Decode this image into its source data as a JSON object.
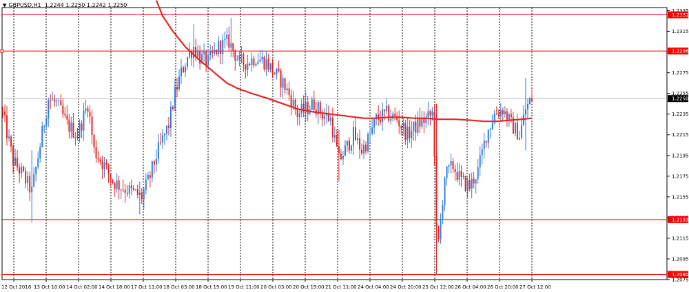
{
  "header": {
    "menu_icon": "dropdown-triangle-icon",
    "symbol": "GBPUSD,H1",
    "open": "1.2244",
    "high": "1.2250",
    "low": "1.2242",
    "close": "1.2250"
  },
  "colors": {
    "bull": "#2f7be0",
    "bear": "#e8231f",
    "ma": "#e8231f",
    "hline": "#ff0000",
    "grid": "#000000",
    "price_line": "#bdbdbd",
    "current_label_bg": "#000000"
  },
  "chart_data": {
    "type": "candlestick",
    "symbol": "GBPUSD",
    "timeframe": "H1",
    "grid": true,
    "ylim": [
      1.2075,
      1.2338
    ],
    "y_ticks": [
      "1.2335",
      "1.2315",
      "1.2295",
      "1.2275",
      "1.2255",
      "1.2235",
      "1.2215",
      "1.2195",
      "1.2175",
      "1.2155",
      "1.2135",
      "1.2115",
      "1.2095",
      "1.2075"
    ],
    "x_labels": [
      "12 Oct 2016",
      "13 Oct 10:00",
      "14 Oct 02:00",
      "14 Oct 18:00",
      "17 Oct 11:00",
      "18 Oct 03:00",
      "18 Oct 19:00",
      "19 Oct 11:00",
      "20 Oct 03:00",
      "20 Oct 19:00",
      "21 Oct 11:00",
      "24 Oct 04:00",
      "24 Oct 20:00",
      "25 Oct 12:00",
      "26 Oct 04:00",
      "26 Oct 20:00",
      "27 Oct 12:00"
    ],
    "horizontal_levels": [
      {
        "price": 1.2331,
        "label": "1.2331"
      },
      {
        "price": 1.2296,
        "label": "1.2296"
      },
      {
        "price": 1.2133,
        "label": "1.2133"
      },
      {
        "price": 1.208,
        "label": "1.2080"
      }
    ],
    "current_price": {
      "price": 1.225,
      "label": "1.2250"
    },
    "bar_count": 256,
    "anchors": [
      [
        0,
        1.2235
      ],
      [
        5,
        1.219
      ],
      [
        10,
        1.2175
      ],
      [
        14,
        1.216
      ],
      [
        18,
        1.2205
      ],
      [
        22,
        1.225
      ],
      [
        26,
        1.2245
      ],
      [
        31,
        1.2225
      ],
      [
        36,
        1.2215
      ],
      [
        41,
        1.2245
      ],
      [
        44,
        1.22
      ],
      [
        49,
        1.2185
      ],
      [
        53,
        1.217
      ],
      [
        57,
        1.2165
      ],
      [
        62,
        1.216
      ],
      [
        67,
        1.2155
      ],
      [
        71,
        1.2175
      ],
      [
        74,
        1.2195
      ],
      [
        77,
        1.221
      ],
      [
        80,
        1.2225
      ],
      [
        83,
        1.2255
      ],
      [
        86,
        1.2275
      ],
      [
        89,
        1.229
      ],
      [
        92,
        1.23
      ],
      [
        95,
        1.229
      ],
      [
        99,
        1.2285
      ],
      [
        104,
        1.23
      ],
      [
        109,
        1.2305
      ],
      [
        114,
        1.2285
      ],
      [
        118,
        1.2285
      ],
      [
        122,
        1.229
      ],
      [
        127,
        1.2285
      ],
      [
        131,
        1.2275
      ],
      [
        135,
        1.2265
      ],
      [
        139,
        1.225
      ],
      [
        142,
        1.2235
      ],
      [
        146,
        1.224
      ],
      [
        150,
        1.2245
      ],
      [
        154,
        1.2235
      ],
      [
        158,
        1.223
      ],
      [
        162,
        1.219
      ],
      [
        165,
        1.22
      ],
      [
        169,
        1.2215
      ],
      [
        173,
        1.22
      ],
      [
        176,
        1.221
      ],
      [
        180,
        1.223
      ],
      [
        185,
        1.2235
      ],
      [
        190,
        1.223
      ],
      [
        195,
        1.2215
      ],
      [
        200,
        1.2225
      ],
      [
        204,
        1.223
      ],
      [
        207,
        1.2235
      ],
      [
        208,
        1.22
      ],
      [
        209,
        1.212
      ],
      [
        210,
        1.211
      ],
      [
        213,
        1.2175
      ],
      [
        217,
        1.2185
      ],
      [
        221,
        1.217
      ],
      [
        225,
        1.2165
      ],
      [
        229,
        1.218
      ],
      [
        233,
        1.2215
      ],
      [
        237,
        1.2235
      ],
      [
        241,
        1.224
      ],
      [
        245,
        1.2225
      ],
      [
        249,
        1.2215
      ],
      [
        252,
        1.224
      ],
      [
        255,
        1.225
      ]
    ],
    "spikes": [
      {
        "bar": 209,
        "low": 1.208,
        "high": 1.2245
      },
      {
        "bar": 14,
        "low": 1.213,
        "high": 1.22
      },
      {
        "bar": 110,
        "low": 1.23,
        "high": 1.2328
      },
      {
        "bar": 92,
        "low": 1.228,
        "high": 1.2322
      },
      {
        "bar": 162,
        "low": 1.217,
        "high": 1.222
      },
      {
        "bar": 66,
        "low": 1.2138,
        "high": 1.217
      },
      {
        "bar": 252,
        "low": 1.22,
        "high": 1.227
      }
    ],
    "moving_average": [
      [
        74,
        1.2345
      ],
      [
        77,
        1.233
      ],
      [
        82,
        1.2315
      ],
      [
        88,
        1.23
      ],
      [
        95,
        1.2287
      ],
      [
        102,
        1.2275
      ],
      [
        108,
        1.2265
      ],
      [
        113,
        1.226
      ],
      [
        120,
        1.2255
      ],
      [
        128,
        1.225
      ],
      [
        135,
        1.2245
      ],
      [
        142,
        1.224
      ],
      [
        150,
        1.2237
      ],
      [
        158,
        1.2235
      ],
      [
        166,
        1.2233
      ],
      [
        174,
        1.2231
      ],
      [
        180,
        1.2231
      ],
      [
        186,
        1.2232
      ],
      [
        192,
        1.2232
      ],
      [
        198,
        1.2231
      ],
      [
        204,
        1.2231
      ],
      [
        210,
        1.223
      ],
      [
        218,
        1.223
      ],
      [
        226,
        1.2229
      ],
      [
        232,
        1.2228
      ],
      [
        238,
        1.2228
      ],
      [
        244,
        1.2229
      ],
      [
        250,
        1.223
      ],
      [
        255,
        1.2231
      ]
    ]
  }
}
